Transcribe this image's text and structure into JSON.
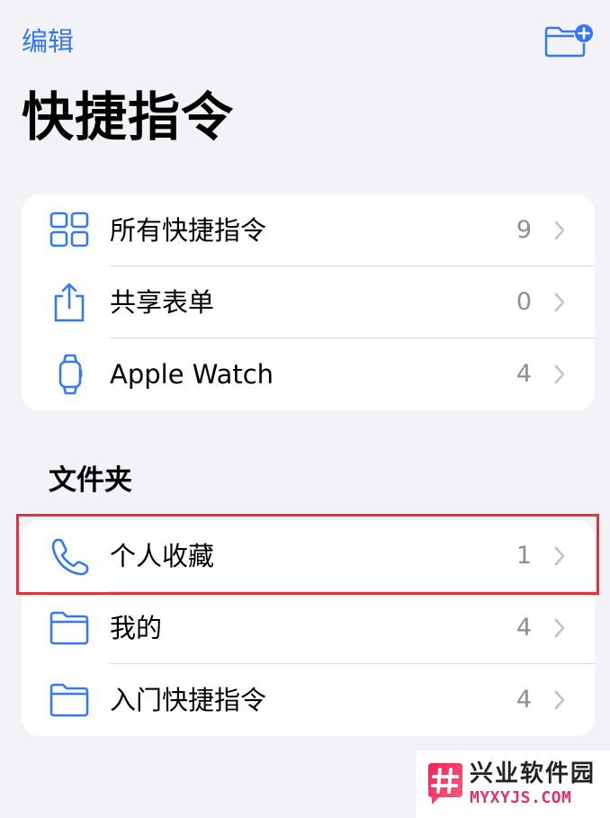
{
  "nav": {
    "edit_label": "编辑",
    "new_folder_icon": "folder-plus-icon"
  },
  "page_title": "快捷指令",
  "top_list": [
    {
      "label": "所有快捷指令",
      "count": "9",
      "icon": "grid-icon"
    },
    {
      "label": "共享表单",
      "count": "0",
      "icon": "share-icon"
    },
    {
      "label": "Apple Watch",
      "count": "4",
      "icon": "watch-icon"
    }
  ],
  "folders_section": {
    "title": "文件夹",
    "items": [
      {
        "label": "个人收藏",
        "count": "1",
        "icon": "phone-icon",
        "highlighted": true
      },
      {
        "label": "我的",
        "count": "4",
        "icon": "folder-icon"
      },
      {
        "label": "入门快捷指令",
        "count": "4",
        "icon": "folder-icon"
      }
    ]
  },
  "watermark": {
    "name": "兴业软件园",
    "url": "MYXYJS.COM"
  },
  "colors": {
    "accent": "#3478f6",
    "background": "#f2f2f7",
    "highlight": "#e2333d",
    "watermark_brand": "#e1306c"
  }
}
